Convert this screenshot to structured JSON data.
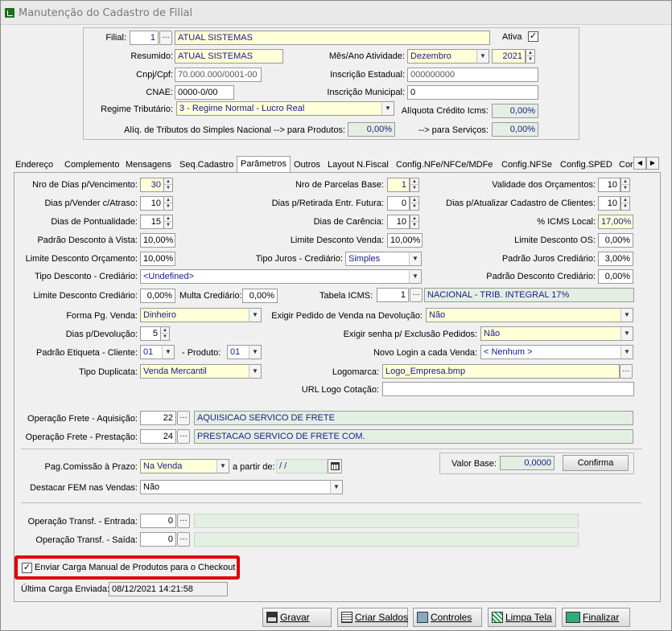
{
  "window": {
    "title": "Manutenção do Cadastro de Filial"
  },
  "header": {
    "filial_label": "Filial:",
    "filial_code": "1",
    "filial_name": "ATUAL SISTEMAS",
    "ativa_label": "Ativa",
    "ativa_checked": true,
    "resumido_label": "Resumido:",
    "resumido_value": "ATUAL SISTEMAS",
    "mes_ano_label": "Mês/Ano Atividade:",
    "mes_value": "Dezembro",
    "ano_value": "2021",
    "cnpj_label": "Cnpj/Cpf:",
    "cnpj_value": "70.000.000/0001-00",
    "ie_label": "Inscrição Estadual:",
    "ie_value": "000000000",
    "cnae_label": "CNAE:",
    "cnae_value": "0000-0/00",
    "im_label": "Inscrição Municipal:",
    "im_value": "0",
    "regime_label": "Regime Tributário:",
    "regime_value": "3 - Regime Normal - Lucro Real",
    "aliq_icms_label": "Alíquota Crédito Icms:",
    "aliq_icms_value": "0,00%",
    "aliq_simples_label": "Alíq. de Tributos do Simples Nacional  --> para Produtos:",
    "aliq_produtos_value": "0,00%",
    "servicos_label": "--> para Serviços:",
    "aliq_servicos_value": "0,00%"
  },
  "tabs": [
    "Endereço",
    "Complemento",
    "Mensagens",
    "Seq.Cadastro",
    "Parâmetros",
    "Outros",
    "Layout N.Fiscal",
    "Config.NFe/NFCe/MDFe",
    "Config.NFSe",
    "Config.SPED",
    "Cor"
  ],
  "params": {
    "nro_dias_venc_label": "Nro de Dias p/Vencimento:",
    "nro_dias_venc": "30",
    "nro_parcelas_label": "Nro de Parcelas Base:",
    "nro_parcelas": "1",
    "validade_orc_label": "Validade dos Orçamentos:",
    "validade_orc": "10",
    "dias_vender_label": "Dias p/Vender c/Atraso:",
    "dias_vender": "10",
    "dias_retirada_label": "Dias p/Retirada Entr. Futura:",
    "dias_retirada": "0",
    "dias_atualizar_label": "Dias p/Atualizar Cadastro de Clientes:",
    "dias_atualizar": "10",
    "dias_pontual_label": "Dias de Pontualidade:",
    "dias_pontual": "15",
    "dias_carencia_label": "Dias de Carência:",
    "dias_carencia": "10",
    "icms_local_label": "% ICMS Local:",
    "icms_local": "17,00%",
    "padrao_desc_vista_label": "Padrão Desconto à Vista:",
    "padrao_desc_vista": "10,00%",
    "limite_desc_venda_label": "Limite Desconto Venda:",
    "limite_desc_venda": "10,00%",
    "limite_desc_os_label": "Limite Desconto OS:",
    "limite_desc_os": "0,00%",
    "limite_desc_orc_label": "Limite Desconto Orçamento:",
    "limite_desc_orc": "10,00%",
    "tipo_juros_label": "Tipo Juros - Crediário:",
    "tipo_juros": "Simples",
    "padrao_juros_label": "Padrão Juros Crediário:",
    "padrao_juros": "3,00%",
    "tipo_desc_cred_label": "Tipo Desconto - Crediário:",
    "tipo_desc_cred": "<Undefined>",
    "padrao_desc_cred_label": "Padrão Desconto Crediário:",
    "padrao_desc_cred": "0,00%",
    "limite_desc_cred_label": "Limite Desconto Crediário:",
    "limite_desc_cred": "0,00%",
    "multa_cred_label": "Multa Crediário:",
    "multa_cred": "0,00%",
    "tabela_icms_label": "Tabela ICMS:",
    "tabela_icms_code": "1",
    "tabela_icms_desc": "NACIONAL - TRIB. INTEGRAL 17%",
    "forma_pg_label": "Forma Pg. Venda:",
    "forma_pg": "Dinheiro",
    "exigir_pedido_label": "Exigir Pedido de Venda na Devolução:",
    "exigir_pedido": "Não",
    "dias_devolucao_label": "Dias p/Devolução:",
    "dias_devolucao": "5",
    "exigir_senha_label": "Exigir senha p/ Exclusão Pedidos:",
    "exigir_senha": "Não",
    "padrao_etiq_label": "Padrão Etiqueta - Cliente:",
    "etiq_cliente": "01",
    "etiq_produto_label": "-   Produto:",
    "etiq_produto": "01",
    "novo_login_label": "Novo Login a cada Venda:",
    "novo_login": "< Nenhum >",
    "tipo_duplicata_label": "Tipo Duplicata:",
    "tipo_duplicata": "Venda Mercantil",
    "logomarca_label": "Logomarca:",
    "logomarca": "Logo_Empresa.bmp",
    "url_logo_label": "URL Logo Cotação:",
    "url_logo": "",
    "op_frete_aq_label": "Operação Frete - Aquisição:",
    "op_frete_aq_code": "22",
    "op_frete_aq_desc": "AQUISICAO SERVICO DE FRETE",
    "op_frete_pr_label": "Operação Frete - Prestação:",
    "op_frete_pr_code": "24",
    "op_frete_pr_desc": "PRESTACAO SERVICO DE FRETE COM.",
    "pag_comissao_label": "Pag.Comissão à Prazo:",
    "pag_comissao": "Na Venda",
    "a_partir_label": "a partir de:",
    "a_partir": " /  /",
    "valor_base_label": "Valor Base:",
    "valor_base": "0,0000",
    "confirma_label": "Confirma",
    "destacar_fem_label": "Destacar FEM nas Vendas:",
    "destacar_fem": "Não",
    "op_transf_ent_label": "Operação Transf. - Entrada:",
    "op_transf_ent": "0",
    "op_transf_sai_label": "Operação Transf. - Saída:",
    "op_transf_sai": "0",
    "enviar_carga_label": "Enviar Carga Manual de Produtos para o Checkout",
    "enviar_carga_checked": true,
    "ultima_carga_label": "Última Carga Enviada:",
    "ultima_carga": "08/12/2021 14:21:58"
  },
  "buttons": {
    "gravar": "Gravar",
    "criar_saldos": "Criar Saldos",
    "controles": "Controles",
    "limpa_tela": "Limpa Tela",
    "finalizar": "Finalizar"
  },
  "colors": {
    "highlight": "#e00000",
    "readonly_bg": "#e4efe4",
    "yellow_bg": "#ffffd8"
  }
}
